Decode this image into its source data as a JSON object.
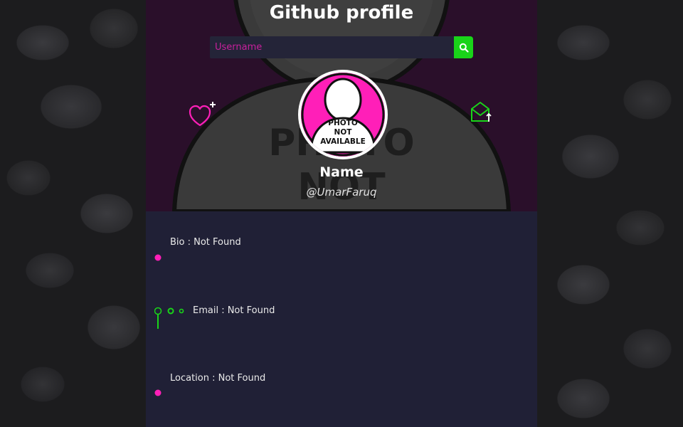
{
  "header": {
    "title": "Github profile"
  },
  "search": {
    "placeholder": "Username",
    "value": ""
  },
  "avatar": {
    "text_line1": "PHOTO",
    "text_line2": "NOT",
    "text_line3": "AVAILABLE",
    "bg_watermark_line1": "PHOTO",
    "bg_watermark_line2": "NOT"
  },
  "profile": {
    "name": "Name",
    "handle": "@UmarFaruq"
  },
  "details": [
    {
      "label": "Bio : Not Found",
      "active": false
    },
    {
      "label": "Email : Not Found",
      "active": true
    },
    {
      "label": "Location : Not Found",
      "active": false
    }
  ],
  "colors": {
    "accent_pink": "#ff1fb8",
    "accent_green": "#19d419",
    "header_bg": "#2a0f2a",
    "info_bg": "#202036"
  },
  "icons": {
    "search": "search-icon",
    "follow": "heart-plus-icon",
    "mail": "mail-upload-icon"
  }
}
